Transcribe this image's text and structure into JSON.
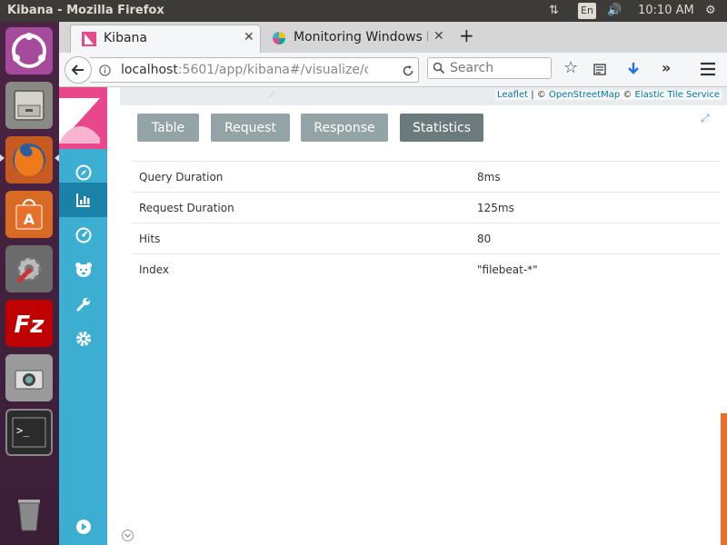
{
  "topbar": {
    "title": "Kibana - Mozilla Firefox",
    "lang": "En",
    "time": "10:10 AM"
  },
  "launcher": {
    "items": [
      "ubuntu-dash",
      "files",
      "firefox",
      "software-center",
      "system-settings",
      "filezilla",
      "screenshot",
      "terminal",
      "trash"
    ]
  },
  "browser": {
    "tabs": [
      {
        "label": "Kibana",
        "icon": "kibana-icon"
      },
      {
        "label": "Monitoring Windows I",
        "icon": "elastic-icon"
      }
    ],
    "url_host": "localhost",
    "url_rest": ":5601/app/kibana#/visualize/c",
    "search_placeholder": "Search"
  },
  "kibana": {
    "nav": [
      "discover",
      "visualize",
      "dashboard",
      "timelion",
      "dev-tools",
      "management"
    ],
    "attribution": {
      "leaflet": "Leaflet",
      "sep1": " | © ",
      "osm": "OpenStreetMap",
      "sep2": " © ",
      "ets": "Elastic Tile Service"
    },
    "tabs": [
      {
        "label": "Table"
      },
      {
        "label": "Request"
      },
      {
        "label": "Response"
      },
      {
        "label": "Statistics"
      }
    ],
    "stats": [
      {
        "key": "Query Duration",
        "value": "8ms"
      },
      {
        "key": "Request Duration",
        "value": "125ms"
      },
      {
        "key": "Hits",
        "value": "80"
      },
      {
        "key": "Index",
        "value": "\"filebeat-*\""
      }
    ]
  },
  "colors": {
    "kibana_nav": "#3caed2",
    "kibana_logo": "#e8488b",
    "button": "#94a3a5",
    "button_active": "#6b7a7c"
  }
}
